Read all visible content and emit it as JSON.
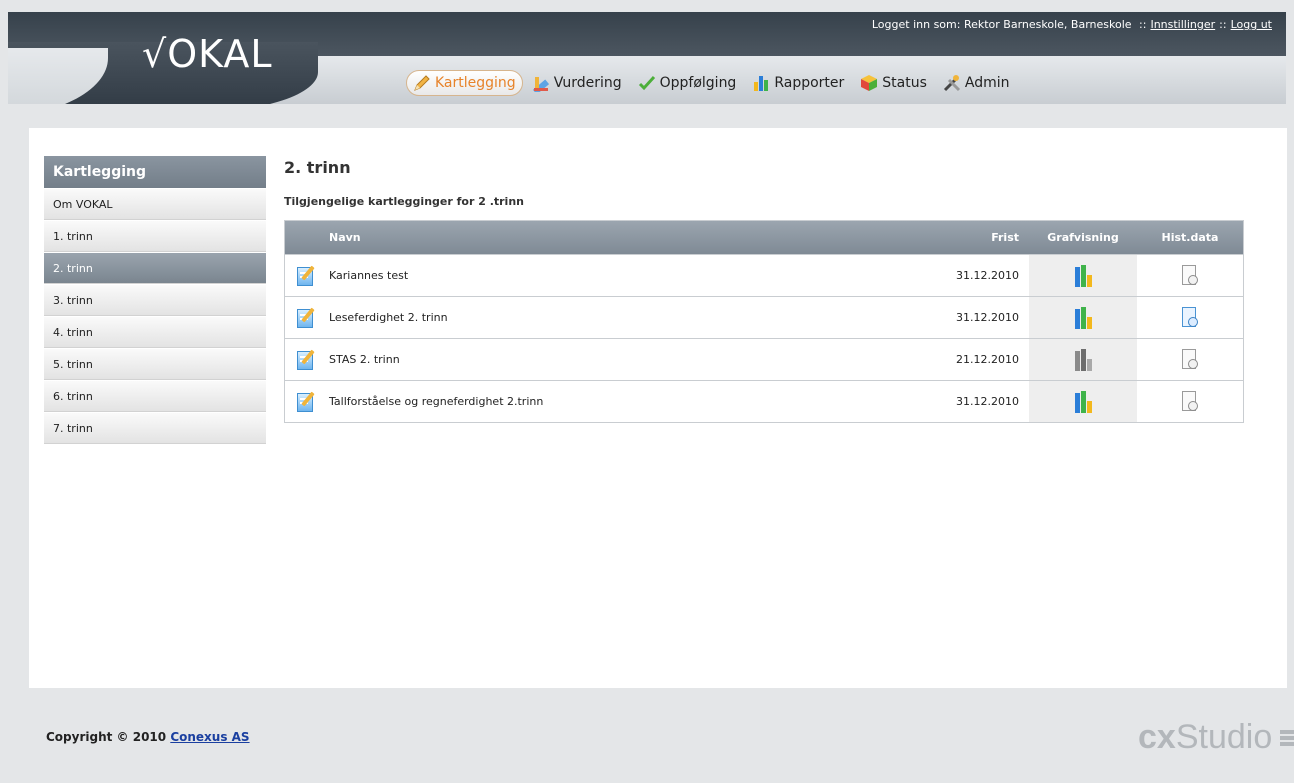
{
  "header": {
    "logo_text": "√OKAL",
    "userbar": {
      "logged_in_text": "Logget inn som:  Rektor Barneskole,  Barneskole",
      "sep": "::",
      "settings_label": "Innstillinger",
      "logout_label": "Logg ut"
    },
    "nav": [
      {
        "label": "Kartlegging",
        "icon": "pencil-icon",
        "active": true
      },
      {
        "label": "Vurdering",
        "icon": "ruler-icon",
        "active": false
      },
      {
        "label": "Oppfølging",
        "icon": "checkmark-icon",
        "active": false
      },
      {
        "label": "Rapporter",
        "icon": "bar-chart-icon",
        "active": false
      },
      {
        "label": "Status",
        "icon": "cube-icon",
        "active": false
      },
      {
        "label": "Admin",
        "icon": "tools-icon",
        "active": false
      }
    ]
  },
  "sidebar": {
    "title": "Kartlegging",
    "items": [
      {
        "label": "Om VOKAL"
      },
      {
        "label": "1. trinn"
      },
      {
        "label": "2. trinn"
      },
      {
        "label": "3. trinn"
      },
      {
        "label": "4. trinn"
      },
      {
        "label": "5. trinn"
      },
      {
        "label": "6. trinn"
      },
      {
        "label": "7. trinn"
      }
    ],
    "active_index": 2
  },
  "main": {
    "title": "2. trinn",
    "subheading": "Tilgjengelige kartlegginger for 2 .trinn",
    "columns": {
      "name": "Navn",
      "deadline": "Frist",
      "graph": "Grafvisning",
      "hist": "Hist.data"
    },
    "rows": [
      {
        "name": "Kariannes test",
        "deadline": "31.12.2010",
        "graph_style": "color",
        "hist_style": "grey"
      },
      {
        "name": "Leseferdighet 2. trinn",
        "deadline": "31.12.2010",
        "graph_style": "color",
        "hist_style": "blue"
      },
      {
        "name": "STAS 2. trinn",
        "deadline": "21.12.2010",
        "graph_style": "grey",
        "hist_style": "grey"
      },
      {
        "name": "Tallforståelse og regneferdighet 2.trinn",
        "deadline": "31.12.2010",
        "graph_style": "color",
        "hist_style": "grey"
      }
    ]
  },
  "footer": {
    "copyright_prefix": "Copyright © 2010",
    "company_link": "Conexus AS",
    "brand_cx": "cx",
    "brand_studio": "Studio"
  },
  "colors": {
    "header_dark": "#36414b",
    "active_nav": "#e7832a",
    "sidebar_active": "#7a858f",
    "grid_header": "#8a95a0"
  }
}
